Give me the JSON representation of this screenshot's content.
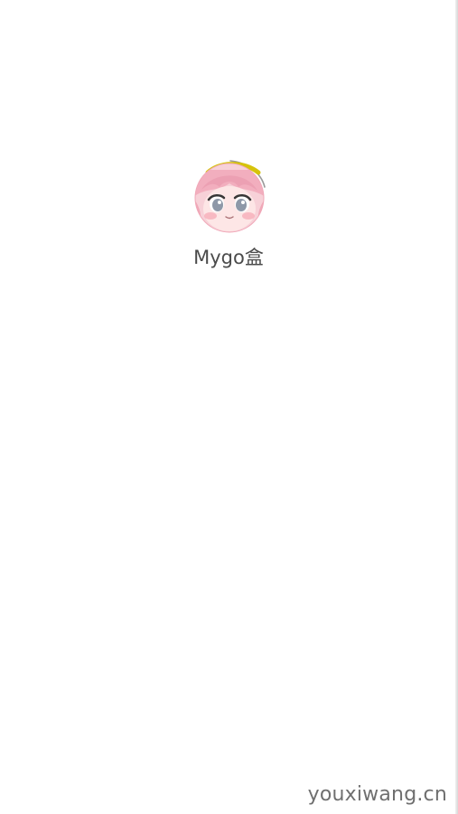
{
  "app": {
    "name": "Mygo盒",
    "icon": "anime-girl-avatar-icon"
  },
  "watermark": {
    "text": "youxiwang.cn"
  },
  "colors": {
    "background": "#ffffff",
    "label_text": "#4b4b4b",
    "watermark_text": "#6f6f6f",
    "icon_ring": "#d6c30b",
    "icon_hair": "#f3b7c7"
  }
}
